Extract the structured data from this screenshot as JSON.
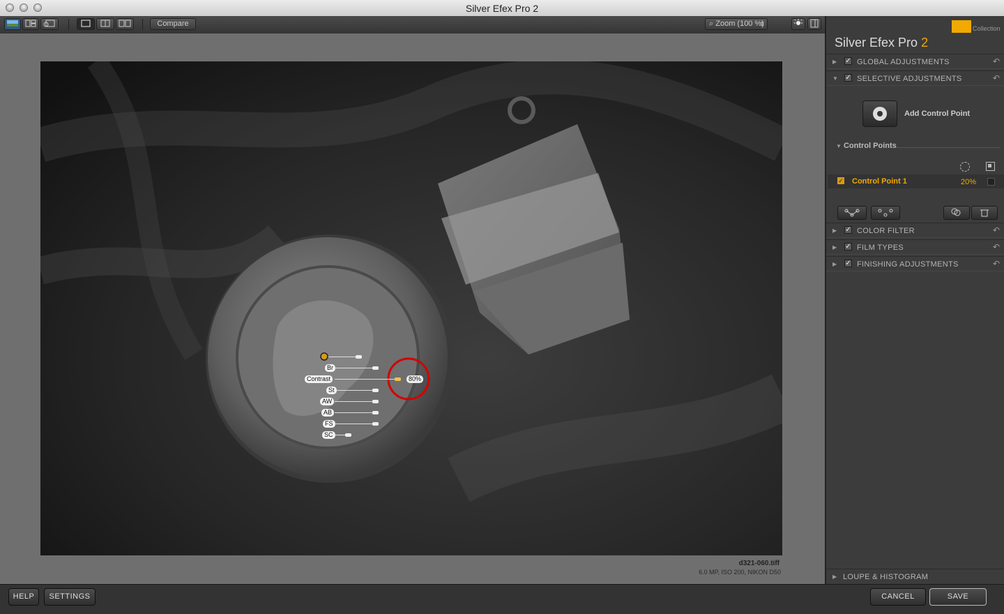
{
  "window": {
    "title": "Silver Efex Pro 2"
  },
  "toolbar": {
    "compare_label": "Compare",
    "zoom_label": "Zoom (100 %)"
  },
  "panel": {
    "brand_name": "Silver Efex Pro",
    "brand_version": "2",
    "collection_label": "Collection",
    "sections_top": [
      {
        "label": "GLOBAL ADJUSTMENTS"
      },
      {
        "label": "SELECTIVE ADJUSTMENTS"
      }
    ],
    "add_control_point_label": "Add Control Point",
    "control_points_header": "Control Points",
    "control_point": {
      "name": "Control Point 1",
      "value": "20%"
    },
    "sections_bottom": [
      {
        "label": "COLOR FILTER"
      },
      {
        "label": "FILM TYPES"
      },
      {
        "label": "FINISHING ADJUSTMENTS"
      }
    ],
    "loupe_label": "LOUPE & HISTOGRAM"
  },
  "image": {
    "filename": "d321-060.tiff",
    "meta": "6.0 MP, ISO 200, NIKON D50",
    "overlay_labels": [
      "Br",
      "Contrast",
      "St",
      "AW",
      "AB",
      "FS",
      "SC"
    ],
    "size_readout": "80%"
  },
  "footer": {
    "help": "HELP",
    "settings": "SETTINGS",
    "cancel": "CANCEL",
    "save": "SAVE"
  },
  "colors": {
    "accent": "#f2a900",
    "panel_bg": "#3c3c3c",
    "preview_bg": "#6f6f6f",
    "highlight_circle": "#e00000"
  }
}
